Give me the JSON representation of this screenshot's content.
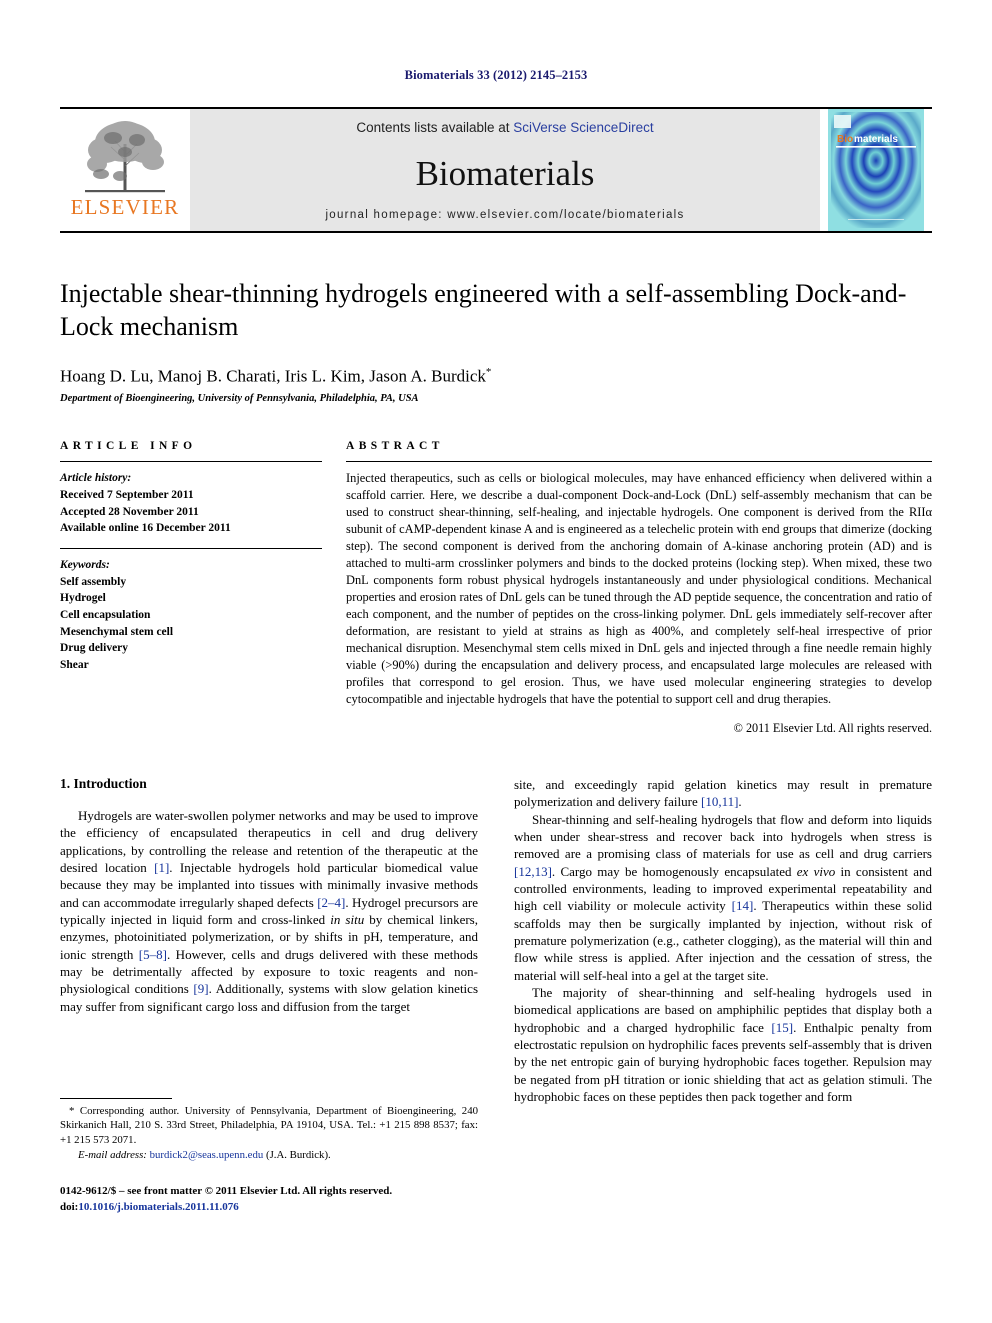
{
  "running_head": "Biomaterials 33 (2012) 2145–2153",
  "masthead": {
    "publisher_logo_name": "elsevier-tree-logo",
    "publisher_wordmark": "ELSEVIER",
    "contents_prefix": "Contents lists available at ",
    "contents_link": "SciVerse ScienceDirect",
    "journal_name": "Biomaterials",
    "homepage": "journal homepage: www.elsevier.com/locate/biomaterials",
    "cover_title": "Biomaterials",
    "colors": {
      "elsevier_orange": "#E87722",
      "link_blue": "#2a3fa0",
      "masthead_grey": "#e6e6e6",
      "cover_blue": "#1b3fb5",
      "cover_teal": "#5fc3c9"
    }
  },
  "article": {
    "title": "Injectable shear-thinning hydrogels engineered with a self-assembling Dock-and-Lock mechanism",
    "authors": "Hoang D. Lu, Manoj B. Charati, Iris L. Kim, Jason A. Burdick",
    "corresponding_marker": "*",
    "affiliation": "Department of Bioengineering, University of Pennsylvania, Philadelphia, PA, USA"
  },
  "article_info": {
    "heading": "ARTICLE INFO",
    "history_label": "Article history:",
    "history": [
      "Received 7 September 2011",
      "Accepted 28 November 2011",
      "Available online 16 December 2011"
    ],
    "keywords_label": "Keywords:",
    "keywords": [
      "Self assembly",
      "Hydrogel",
      "Cell encapsulation",
      "Mesenchymal stem cell",
      "Drug delivery",
      "Shear"
    ]
  },
  "abstract": {
    "heading": "ABSTRACT",
    "text": "Injected therapeutics, such as cells or biological molecules, may have enhanced efficiency when delivered within a scaffold carrier. Here, we describe a dual-component Dock-and-Lock (DnL) self-assembly mechanism that can be used to construct shear-thinning, self-healing, and injectable hydrogels. One component is derived from the RIIα subunit of cAMP-dependent kinase A and is engineered as a telechelic protein with end groups that dimerize (docking step). The second component is derived from the anchoring domain of A-kinase anchoring protein (AD) and is attached to multi-arm crosslinker polymers and binds to the docked proteins (locking step). When mixed, these two DnL components form robust physical hydrogels instantaneously and under physiological conditions. Mechanical properties and erosion rates of DnL gels can be tuned through the AD peptide sequence, the concentration and ratio of each component, and the number of peptides on the cross-linking polymer. DnL gels immediately self-recover after deformation, are resistant to yield at strains as high as 400%, and completely self-heal irrespective of prior mechanical disruption. Mesenchymal stem cells mixed in DnL gels and injected through a fine needle remain highly viable (>90%) during the encapsulation and delivery process, and encapsulated large molecules are released with profiles that correspond to gel erosion. Thus, we have used molecular engineering strategies to develop cytocompatible and injectable hydrogels that have the potential to support cell and drug therapies.",
    "copyright": "© 2011 Elsevier Ltd. All rights reserved."
  },
  "introduction": {
    "heading": "1. Introduction",
    "left_paragraphs": [
      "Hydrogels are water-swollen polymer networks and may be used to improve the efficiency of encapsulated therapeutics in cell and drug delivery applications, by controlling the release and retention of the therapeutic at the desired location [1]. Injectable hydrogels hold particular biomedical value because they may be implanted into tissues with minimally invasive methods and can accommodate irregularly shaped defects [2–4]. Hydrogel precursors are typically injected in liquid form and cross-linked in situ by chemical linkers, enzymes, photoinitiated polymerization, or by shifts in pH, temperature, and ionic strength [5–8]. However, cells and drugs delivered with these methods may be detrimentally affected by exposure to toxic reagents and non-physiological conditions [9]. Additionally, systems with slow gelation kinetics may suffer from significant cargo loss and diffusion from the target"
    ],
    "right_paragraphs": [
      "site, and exceedingly rapid gelation kinetics may result in premature polymerization and delivery failure [10,11].",
      "Shear-thinning and self-healing hydrogels that flow and deform into liquids when under shear-stress and recover back into hydrogels when stress is removed are a promising class of materials for use as cell and drug carriers [12,13]. Cargo may be homogenously encapsulated ex vivo in consistent and controlled environments, leading to improved experimental repeatability and high cell viability or molecule activity [14]. Therapeutics within these solid scaffolds may then be surgically implanted by injection, without risk of premature polymerization (e.g., catheter clogging), as the material will thin and flow while stress is applied. After injection and the cessation of stress, the material will self-heal into a gel at the target site.",
      "The majority of shear-thinning and self-healing hydrogels used in biomedical applications are based on amphiphilic peptides that display both a hydrophobic and a charged hydrophilic face [15]. Enthalpic penalty from electrostatic repulsion on hydrophilic faces prevents self-assembly that is driven by the net entropic gain of burying hydrophobic faces together. Repulsion may be negated from pH titration or ionic shielding that act as gelation stimuli. The hydrophobic faces on these peptides then pack together and form"
    ]
  },
  "footnote": {
    "corresponding": "* Corresponding author. University of Pennsylvania, Department of Bioengineering, 240 Skirkanich Hall, 210 S. 33rd Street, Philadelphia, PA 19104, USA. Tel.: +1 215 898 8537; fax: +1 215 573 2071.",
    "email_label": "E-mail address:",
    "email": "burdick2@seas.upenn.edu",
    "email_attribution": "(J.A. Burdick)."
  },
  "imprint": {
    "issn_line": "0142-9612/$ – see front matter © 2011 Elsevier Ltd. All rights reserved.",
    "doi_prefix": "doi:",
    "doi": "10.1016/j.biomaterials.2011.11.076"
  }
}
